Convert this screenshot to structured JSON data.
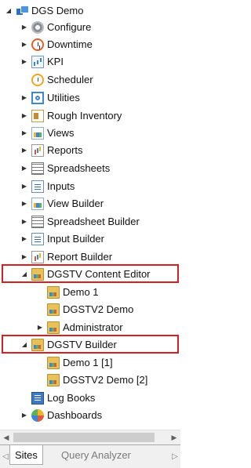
{
  "tree": {
    "items": [
      {
        "label": "DGS Demo",
        "icon": "database-site-icon",
        "arrow": "expanded"
      },
      {
        "label": "Configure",
        "icon": "gear-icon",
        "arrow": "collapsed"
      },
      {
        "label": "Downtime",
        "icon": "alarm-clock-icon",
        "arrow": "collapsed"
      },
      {
        "label": "KPI",
        "icon": "kpi-chart-icon",
        "arrow": "collapsed"
      },
      {
        "label": "Scheduler",
        "icon": "scheduler-clock-icon",
        "arrow": "none"
      },
      {
        "label": "Utilities",
        "icon": "utilities-icon",
        "arrow": "collapsed"
      },
      {
        "label": "Rough Inventory",
        "icon": "inventory-document-icon",
        "arrow": "collapsed"
      },
      {
        "label": "Views",
        "icon": "views-chart-icon",
        "arrow": "collapsed"
      },
      {
        "label": "Reports",
        "icon": "reports-icon",
        "arrow": "collapsed"
      },
      {
        "label": "Spreadsheets",
        "icon": "spreadsheet-icon",
        "arrow": "collapsed"
      },
      {
        "label": "Inputs",
        "icon": "inputs-icon",
        "arrow": "collapsed"
      },
      {
        "label": "View Builder",
        "icon": "view-builder-icon",
        "arrow": "collapsed"
      },
      {
        "label": "Spreadsheet Builder",
        "icon": "spreadsheet-builder-icon",
        "arrow": "collapsed"
      },
      {
        "label": "Input Builder",
        "icon": "input-builder-icon",
        "arrow": "collapsed"
      },
      {
        "label": "Report Builder",
        "icon": "report-builder-icon",
        "arrow": "collapsed"
      },
      {
        "label": "DGSTV Content Editor",
        "icon": "dgstv-folder-icon",
        "arrow": "expanded"
      },
      {
        "label": "Demo 1",
        "icon": "dgstv-folder-icon",
        "arrow": "none"
      },
      {
        "label": "DGSTV2 Demo",
        "icon": "dgstv-folder-icon",
        "arrow": "none"
      },
      {
        "label": "Administrator",
        "icon": "dgstv-folder-icon",
        "arrow": "collapsed"
      },
      {
        "label": "DGSTV Builder",
        "icon": "dgstv-folder-icon",
        "arrow": "expanded"
      },
      {
        "label": "Demo 1 [1]",
        "icon": "dgstv-folder-icon",
        "arrow": "none"
      },
      {
        "label": "DGSTV2 Demo [2]",
        "icon": "dgstv-folder-icon",
        "arrow": "none"
      },
      {
        "label": "Log Books",
        "icon": "log-book-icon",
        "arrow": "none"
      },
      {
        "label": "Dashboards",
        "icon": "dashboard-icon",
        "arrow": "collapsed"
      }
    ]
  },
  "tabs": [
    {
      "label": "Sites",
      "active": true
    },
    {
      "label": "Query Analyzer",
      "active": false
    }
  ],
  "colors": {
    "highlight": "#d42020",
    "background": "#ffffff",
    "chrome": "#f0f0f0"
  }
}
